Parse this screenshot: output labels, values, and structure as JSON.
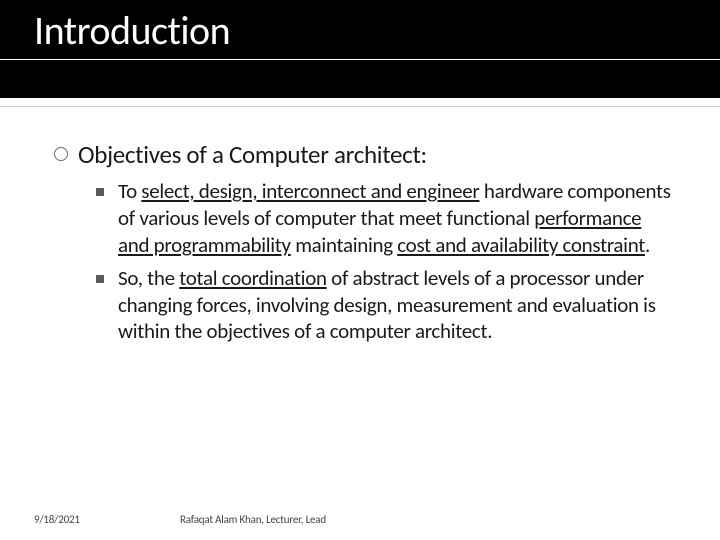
{
  "title": "Introduction",
  "heading": "Objectives of a Computer architect:",
  "item1": {
    "a": "To ",
    "b": "select, design, interconnect and engineer",
    "c": " hardware components of various levels of computer that meet functional ",
    "d": "performance and programmability",
    "e": " maintaining ",
    "f": "cost  and availability constraint",
    "g": "."
  },
  "item2": {
    "a": "So, the ",
    "b": "total coordination",
    "c": " of abstract levels of a processor under changing forces, involving design, measurement and evaluation is within the objectives of a computer architect."
  },
  "footer": {
    "date": "9/18/2021",
    "author": "Rafaqat Alam Khan, Lecturer, Lead"
  }
}
